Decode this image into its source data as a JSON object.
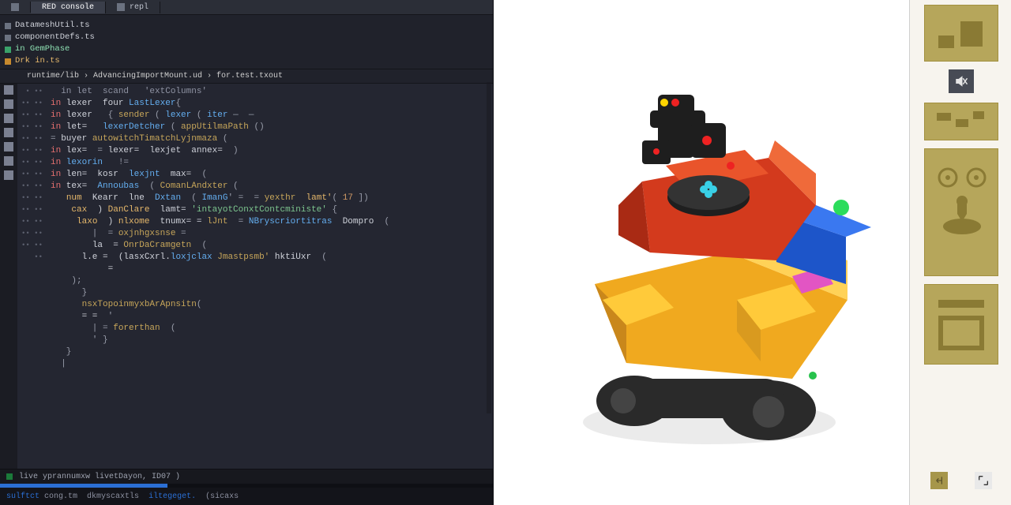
{
  "tabs": [
    {
      "label": "RED console",
      "active": true
    },
    {
      "label": "repl"
    }
  ],
  "tree": [
    {
      "icon": "#6b7280",
      "label": "DatameshUtil.ts"
    },
    {
      "icon": "#6b7280",
      "label": "componentDefs.ts"
    },
    {
      "icon": "#3aa26a",
      "label": "in GemPhase"
    },
    {
      "icon": "#c78a2e",
      "label": "Drk in.ts"
    }
  ],
  "path_bar": "runtime/lib › AdvancingImportMount.ud › for.test.txout",
  "code_top": "  in let  scand   'extColumns'",
  "code_lines": [
    [
      [
        "kw",
        "in"
      ],
      [
        "id",
        " lexer  four "
      ],
      [
        "type",
        "LastLexer"
      ],
      [
        "op",
        "{"
      ]
    ],
    [
      [
        "kw",
        "in"
      ],
      [
        "id",
        " lexer   "
      ],
      [
        "op",
        "{ "
      ],
      [
        "fn",
        "sender"
      ],
      [
        "op",
        " ( "
      ],
      [
        "type",
        "lexer"
      ],
      [
        "op",
        " ( "
      ],
      [
        "type",
        "iter"
      ],
      [
        "op",
        " — "
      ],
      [
        "op",
        " —"
      ]
    ],
    [
      [
        "kw",
        "in"
      ],
      [
        "id",
        " let=   "
      ],
      [
        "type",
        "lexerDetcher"
      ],
      [
        "op",
        " ( "
      ],
      [
        "fn",
        "appUtilmaPath"
      ],
      [
        "op",
        " ()"
      ]
    ],
    [
      [
        "op",
        "= "
      ],
      [
        "id",
        "buyer "
      ],
      [
        "fn",
        "autowitchTimatchLyjnmaza"
      ],
      [
        "op",
        " ("
      ]
    ],
    [
      [
        "kw",
        "in"
      ],
      [
        "id",
        " lex="
      ],
      [
        "op",
        "  = "
      ],
      [
        "id",
        "lexer="
      ],
      [
        "op",
        "  "
      ],
      [
        "id",
        "lexjet  annex="
      ],
      [
        "op",
        "  )"
      ]
    ],
    [
      [
        "kw",
        "in"
      ],
      [
        "type",
        " lexorin"
      ],
      [
        "op",
        "   !="
      ]
    ],
    [
      [
        "kw",
        "in"
      ],
      [
        "id",
        " len=  kosr  "
      ],
      [
        "type",
        "lexjnt"
      ],
      [
        "id",
        "  max="
      ],
      [
        "op",
        "  ("
      ]
    ],
    [
      [
        "kw",
        "in"
      ],
      [
        "id",
        " tex=  "
      ],
      [
        "type",
        "Annoubas"
      ],
      [
        "op",
        "  ( "
      ],
      [
        "fn",
        "ComanLAndxter"
      ],
      [
        "op",
        " ("
      ]
    ],
    [
      [
        "op",
        "   "
      ],
      [
        "prop",
        "num"
      ],
      [
        "id",
        "  Kearr  lne  "
      ],
      [
        "type",
        "Dxtan"
      ],
      [
        "op",
        "  ( "
      ],
      [
        "type",
        "ImanG"
      ],
      [
        "op",
        "' =  = "
      ],
      [
        "fn",
        "yexthr  "
      ],
      [
        "prop",
        "lamt'"
      ],
      [
        "op",
        "( "
      ],
      [
        "num",
        "17"
      ],
      [
        "op",
        " ])"
      ]
    ],
    [
      [
        "op",
        "    "
      ],
      [
        "prop",
        "cax"
      ],
      [
        "id",
        "  ) "
      ],
      [
        "prop",
        "DanClare"
      ],
      [
        "id",
        "  lamt= "
      ],
      [
        "str",
        "'intayotConxtContcministe'"
      ],
      [
        "op",
        " {"
      ]
    ],
    [
      [
        "op",
        "     "
      ],
      [
        "prop",
        "laxo"
      ],
      [
        "id",
        "  ) "
      ],
      [
        "prop",
        "nlxome"
      ],
      [
        "id",
        "  tnumx= = "
      ],
      [
        "fn",
        "lJnt"
      ],
      [
        "op",
        "  = "
      ],
      [
        "type",
        "NBryscriortitras  "
      ],
      [
        "id",
        "Dompro"
      ],
      [
        "op",
        "  ("
      ]
    ],
    [
      [
        "op",
        "        |  = "
      ],
      [
        "fn",
        "oxjnhgxsnse"
      ],
      [
        "op",
        " ="
      ]
    ],
    [
      [
        "op",
        "        "
      ],
      [
        "id",
        "la  = "
      ],
      [
        "fn",
        "OnrDaCramgetn"
      ],
      [
        "op",
        "  ("
      ]
    ],
    [
      [
        "op",
        ""
      ]
    ],
    [
      [
        "op",
        "      "
      ],
      [
        "id",
        "l.e =  ("
      ],
      [
        "id",
        "lasxCxrl."
      ],
      [
        "type",
        "loxjclax "
      ],
      [
        "fn",
        "Jmastpsmb' "
      ],
      [
        "id",
        "hktiUxr"
      ],
      [
        "op",
        "  ("
      ]
    ],
    [
      [
        "op",
        "           "
      ],
      [
        "id",
        "="
      ]
    ],
    [
      [
        "op",
        "    );"
      ]
    ],
    [
      [
        "op",
        ""
      ]
    ],
    [
      [
        "op",
        "      }"
      ]
    ],
    [
      [
        "op",
        "      "
      ],
      [
        "fn",
        "nsxTopoinmyxbArApnsitn"
      ],
      [
        "op",
        "("
      ]
    ],
    [
      [
        "op",
        "      "
      ],
      [
        "id",
        "= ="
      ],
      [
        "op",
        "  '"
      ]
    ],
    [
      [
        "op",
        "        | ="
      ],
      [
        "fn",
        " forerthan"
      ],
      [
        "op",
        "  ("
      ]
    ],
    [
      [
        "op",
        "        ' }"
      ]
    ],
    [
      [
        "op",
        ""
      ]
    ],
    [
      [
        "op",
        "   }"
      ]
    ],
    [
      [
        "op",
        ""
      ]
    ],
    [
      [
        "op",
        "  |"
      ]
    ]
  ],
  "gutter": {
    "start": 1,
    "count": 28
  },
  "console": {
    "text": "live yprannumxw livetDayon, ID07 )"
  },
  "statusbar": {
    "left": "sulftct  cong.tm  dkmyscaxtls  iltegeget.  (sicaxs"
  },
  "gallery": {
    "tool_icon": "mute-icon",
    "thumbs": [
      "thumb-1",
      "thumb-2",
      "thumb-3",
      "thumb-4",
      "thumb-5"
    ],
    "bottom_tools": [
      "share-icon",
      "expand-icon"
    ]
  },
  "preview_alt": "isometric colorful robot render"
}
